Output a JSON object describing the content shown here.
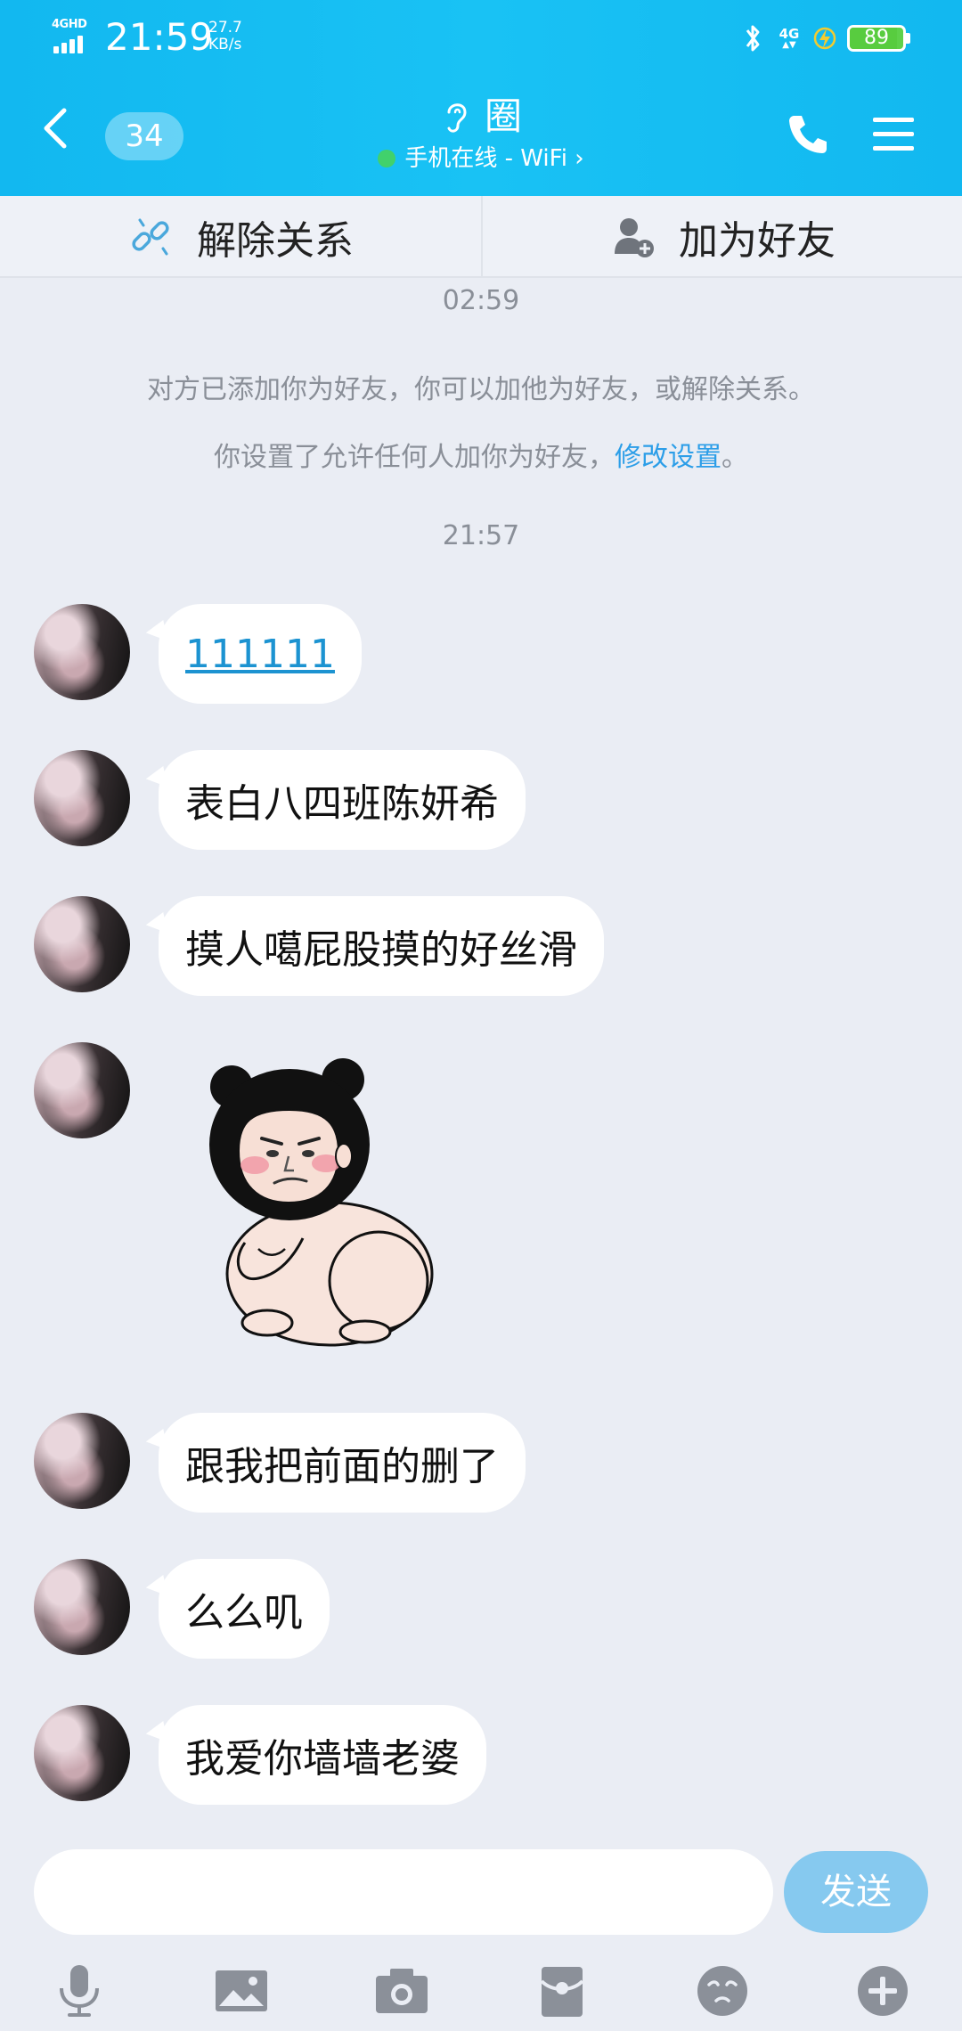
{
  "status_bar": {
    "network_tag": "4GHD",
    "time": "21:59",
    "speed_value": "27.7",
    "speed_unit": "KB/s",
    "mobile_tag": "4G",
    "battery_level": "89",
    "battery_fraction": 0.89
  },
  "navbar": {
    "unread_count": "34",
    "title": "圈",
    "subtitle": "手机在线 - WiFi ›"
  },
  "actions": {
    "unlink_label": "解除关系",
    "add_friend_label": "加为好友"
  },
  "chat": {
    "timestamp_1": "02:59",
    "system_line_1": "对方已添加你为好友，你可以加他为好友，或解除关系。",
    "system_line_2_prefix": "你设置了允许任何人加你为好友，",
    "system_line_2_link": "修改设置",
    "system_line_2_suffix": "。",
    "timestamp_2": "21:57",
    "messages": [
      {
        "type": "text",
        "text": "111111"
      },
      {
        "type": "text",
        "text": "表白八四班陈妍希"
      },
      {
        "type": "text",
        "text": "摸人噶屁股摸的好丝滑"
      },
      {
        "type": "sticker",
        "icon": "cartoon-girl-sticker"
      },
      {
        "type": "text",
        "text": "跟我把前面的删了"
      },
      {
        "type": "text",
        "text": "么么叽"
      },
      {
        "type": "text",
        "text": "我爱你墙墙老婆"
      }
    ]
  },
  "input": {
    "placeholder": "",
    "value": "",
    "send_label": "发送"
  },
  "toolbar": {
    "icons": [
      "microphone-icon",
      "image-icon",
      "camera-icon",
      "red-packet-icon",
      "emoji-icon",
      "plus-icon"
    ]
  },
  "colors": {
    "header": "#19c2f4",
    "link": "#2c9ee8",
    "send_button": "#86c9ef",
    "online": "#41d16c",
    "battery": "#58cc3f"
  }
}
